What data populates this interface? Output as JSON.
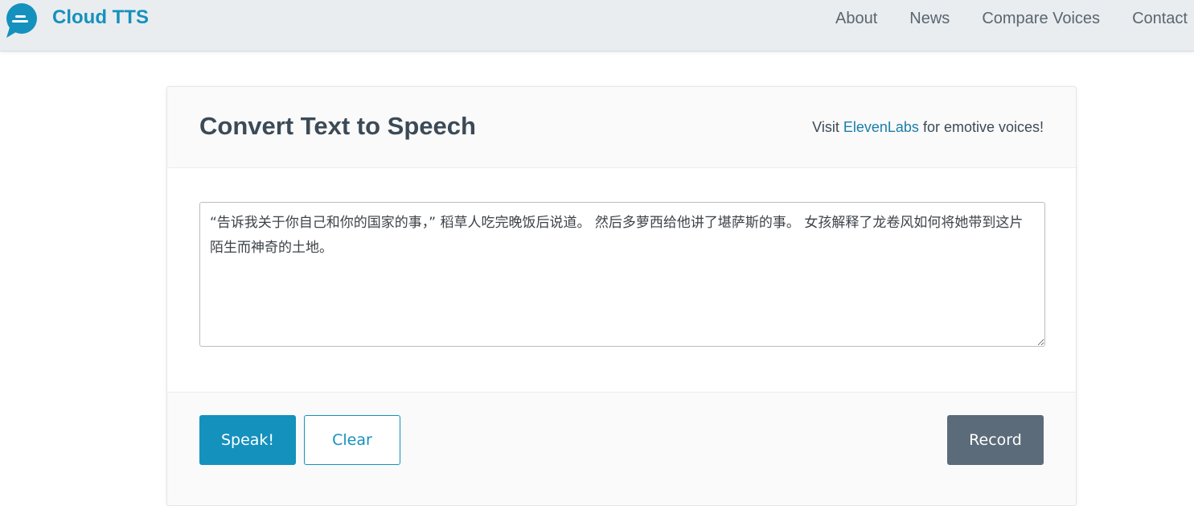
{
  "nav": {
    "brand_name": "Cloud TTS",
    "links": [
      "About",
      "News",
      "Compare Voices",
      "Contact"
    ]
  },
  "card": {
    "title": "Convert Text to Speech",
    "promo": {
      "prefix": "Visit ",
      "link_text": "ElevenLabs",
      "suffix": " for emotive voices!"
    },
    "textarea_value": "“告诉我关于你自己和你的国家的事，” 稻草人吃完晚饭后说道。 然后多萝西给他讲了堪萨斯的事。 女孩解释了龙卷风如何将她带到这片陌生而神奇的土地。"
  },
  "buttons": {
    "speak": "Speak!",
    "clear": "Clear",
    "record": "Record"
  },
  "icons": {
    "logo": "speech-bubble-icon"
  },
  "colors": {
    "brand": "#1591bd",
    "navbar_bg": "#e9edf0",
    "record_button": "#5b6b79",
    "heading": "#3b4a57"
  }
}
